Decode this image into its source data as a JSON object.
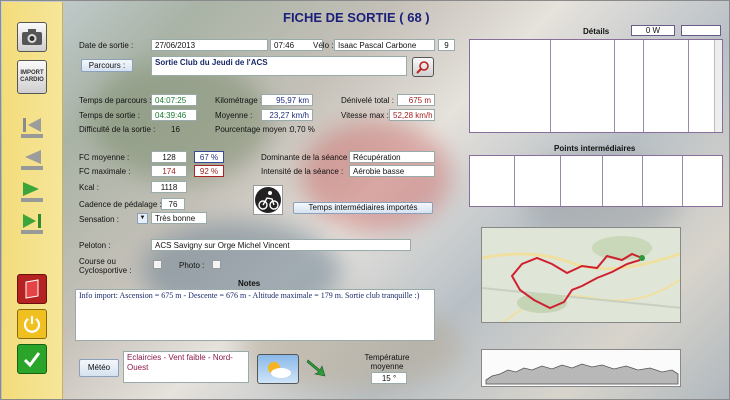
{
  "title": "FICHE DE SORTIE ( 68 )",
  "date": {
    "label": "Date de sortie :",
    "value": "27/06/2013",
    "time": "07:46"
  },
  "velo": {
    "label": "Vélo :",
    "value": "Isaac Pascal Carbone",
    "num": "9"
  },
  "parcours": {
    "button": "Parcours :",
    "value": "Sortie Club du Jeudi de l'ACS"
  },
  "stats": {
    "temps_parcours_label": "Temps de parcours :",
    "temps_parcours": "04:07:25",
    "temps_sortie_label": "Temps de sortie :",
    "temps_sortie": "04:39:46",
    "difficulte_label": "Difficulté de la sortie :",
    "difficulte": "16",
    "kilometrage_label": "Kilométrage :",
    "kilometrage": "95,97 km",
    "moyenne_label": "Moyenne :",
    "moyenne": "23,27 km/h",
    "pourcentage_label": "Pourcentage moyen :",
    "pourcentage": "0,70 %",
    "denivele_label": "Dénivelé total :",
    "denivele": "675 m",
    "vitesse_label": "Vitesse max :",
    "vitesse": "52,28 km/h"
  },
  "physio": {
    "fc_moy_label": "FC moyenne :",
    "fc_moy": "128",
    "fc_moy_pct": "67 %",
    "fc_max_label": "FC maximale :",
    "fc_max": "174",
    "fc_max_pct": "92 %",
    "kcal_label": "Kcal :",
    "kcal": "1118",
    "cadence_label": "Cadence de pédalage :",
    "cadence": "76",
    "sensation_label": "Sensation :",
    "sensation": "Très bonne"
  },
  "seance": {
    "dominante_label": "Dominante de la séance :",
    "dominante": "Récupération",
    "intensite_label": "Intensité de la séance :",
    "intensite": "Aérobie basse",
    "temps_btn": "Temps intermédiaires importés"
  },
  "peloton": {
    "label": "Peloton :",
    "value": "ACS Savigny sur Orge Michel Vincent"
  },
  "course": {
    "label": "Course ou Cyclosportive :",
    "photo_label": "Photo :"
  },
  "notes": {
    "label": "Notes",
    "text": "Info import: Ascension = 675 m - Descente = 676 m - Altitude maximale = 179 m. Sortie club tranquille :)"
  },
  "meteo": {
    "button": "Météo",
    "value": "Eclaircies - Vent faible - Nord-Ouest",
    "temp_label": "Température moyenne",
    "temp": "15 °"
  },
  "details": {
    "label": "Détails",
    "watts": "0 W"
  },
  "points": {
    "label": "Points intermédiaires"
  },
  "sidebar": {
    "import_label": "IMPORT CARDIO"
  },
  "colors": {
    "sidebar": "#f4de80",
    "title": "#1b1f7a",
    "green_value": "#1d7a2d",
    "red_value": "#a22020",
    "route": "#d02030"
  }
}
